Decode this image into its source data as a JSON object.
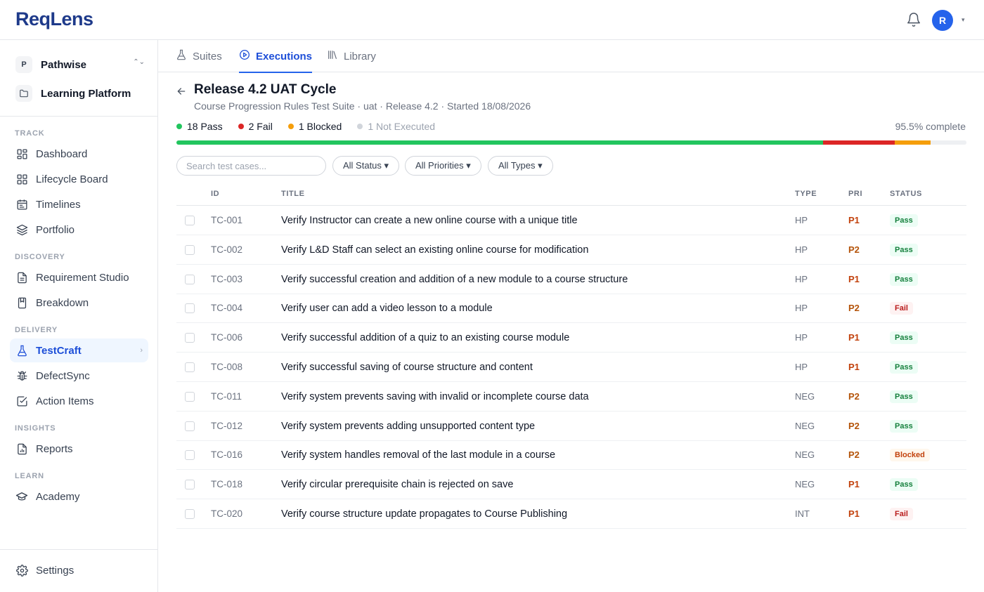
{
  "app": {
    "logo": "ReqLens",
    "user_initial": "R"
  },
  "colors": {
    "accent": "#2563eb",
    "pass": "#22c55e",
    "fail": "#dc2626",
    "blocked": "#f59e0b",
    "not_executed": "#d1d5db",
    "p1": "#c2410c",
    "p2": "#b45309"
  },
  "sidebar": {
    "project": {
      "badge": "P",
      "name": "Pathwise"
    },
    "workspace": {
      "name": "Learning Platform"
    },
    "sections": {
      "track": "TRACK",
      "discovery": "DISCOVERY",
      "delivery": "DELIVERY",
      "insights": "INSIGHTS",
      "learn": "LEARN"
    },
    "items": {
      "dashboard": "Dashboard",
      "lifecycle": "Lifecycle Board",
      "timelines": "Timelines",
      "portfolio": "Portfolio",
      "requirement_studio": "Requirement Studio",
      "breakdown": "Breakdown",
      "testcraft": "TestCraft",
      "defectsync": "DefectSync",
      "action_items": "Action Items",
      "reports": "Reports",
      "academy": "Academy",
      "settings": "Settings"
    }
  },
  "tabs": {
    "suites": "Suites",
    "executions": "Executions",
    "library": "Library"
  },
  "header": {
    "title": "Release 4.2 UAT Cycle",
    "subtitle": "Course Progression Rules Test Suite · uat · Release 4.2 · Started 18/08/2026"
  },
  "stats": {
    "pass": "18 Pass",
    "fail": "2 Fail",
    "blocked": "1 Blocked",
    "not_executed": "1 Not Executed",
    "complete": "95.5% complete"
  },
  "progress": {
    "pass": 18,
    "fail": 2,
    "blocked": 1,
    "not_executed": 1
  },
  "filters": {
    "search_placeholder": "Search test cases...",
    "status": "All Status ▾",
    "priorities": "All Priorities ▾",
    "types": "All Types ▾"
  },
  "table": {
    "headers": {
      "id": "ID",
      "title": "TITLE",
      "type": "TYPE",
      "pri": "PRI",
      "status": "STATUS"
    },
    "rows": [
      {
        "id": "TC-001",
        "title": "Verify Instructor can create a new online course with a unique title",
        "type": "HP",
        "pri": "P1",
        "status": "Pass"
      },
      {
        "id": "TC-002",
        "title": "Verify L&D Staff can select an existing online course for modification",
        "type": "HP",
        "pri": "P2",
        "status": "Pass"
      },
      {
        "id": "TC-003",
        "title": "Verify successful creation and addition of a new module to a course structure",
        "type": "HP",
        "pri": "P1",
        "status": "Pass"
      },
      {
        "id": "TC-004",
        "title": "Verify user can add a video lesson to a module",
        "type": "HP",
        "pri": "P2",
        "status": "Fail"
      },
      {
        "id": "TC-006",
        "title": "Verify successful addition of a quiz to an existing course module",
        "type": "HP",
        "pri": "P1",
        "status": "Pass"
      },
      {
        "id": "TC-008",
        "title": "Verify successful saving of course structure and content",
        "type": "HP",
        "pri": "P1",
        "status": "Pass"
      },
      {
        "id": "TC-011",
        "title": "Verify system prevents saving with invalid or incomplete course data",
        "type": "NEG",
        "pri": "P2",
        "status": "Pass"
      },
      {
        "id": "TC-012",
        "title": "Verify system prevents adding unsupported content type",
        "type": "NEG",
        "pri": "P2",
        "status": "Pass"
      },
      {
        "id": "TC-016",
        "title": "Verify system handles removal of the last module in a course",
        "type": "NEG",
        "pri": "P2",
        "status": "Blocked"
      },
      {
        "id": "TC-018",
        "title": "Verify circular prerequisite chain is rejected on save",
        "type": "NEG",
        "pri": "P1",
        "status": "Pass"
      },
      {
        "id": "TC-020",
        "title": "Verify course structure update propagates to Course Publishing",
        "type": "INT",
        "pri": "P1",
        "status": "Fail"
      }
    ]
  }
}
